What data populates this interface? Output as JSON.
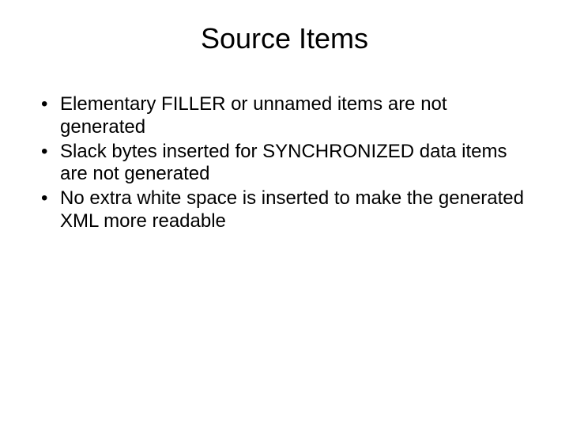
{
  "title": "Source Items",
  "bullets": [
    "Elementary FILLER or unnamed items are not generated",
    "Slack bytes inserted for SYNCHRONIZED data items are not generated",
    "No extra white space is inserted to make the generated XML more readable"
  ]
}
